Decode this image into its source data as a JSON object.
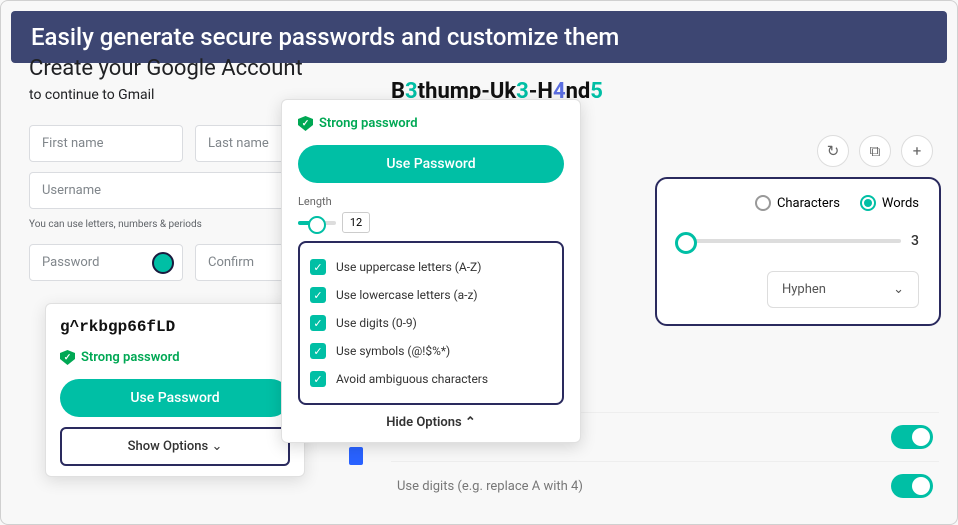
{
  "banner": "Easily generate secure passwords and customize them",
  "google": {
    "title": "Create your Google Account",
    "subtitle": "to continue to Gmail",
    "first_name": "First name",
    "last_name": "Last name",
    "username": "Username",
    "hint": "You can use letters, numbers & periods",
    "password": "Password",
    "confirm": "Confirm",
    "at": "@"
  },
  "popup1": {
    "password": "g^rkbgp66fLD",
    "strong": "Strong password",
    "use": "Use Password",
    "show": "Show Options"
  },
  "popup2": {
    "strong": "Strong password",
    "use": "Use Password",
    "length_label": "Length",
    "length_value": "12",
    "options": [
      "Use uppercase letters (A-Z)",
      "Use lowercase letters (a-z)",
      "Use digits (0-9)",
      "Use symbols (@!$%*)",
      "Avoid ambiguous characters"
    ],
    "hide": "Hide Options"
  },
  "right": {
    "password_parts": [
      "B",
      "3",
      "thump-Uk",
      "3",
      "-H",
      "4",
      "nd",
      "5"
    ],
    "characters": "Characters",
    "words": "Words",
    "word_count": "3",
    "separator": "Hyphen"
  },
  "toggles": {
    "row1": "",
    "row2": "Use digits (e.g. replace A with 4)"
  },
  "chevron_down": "⌄",
  "chevron_up": "⌃"
}
